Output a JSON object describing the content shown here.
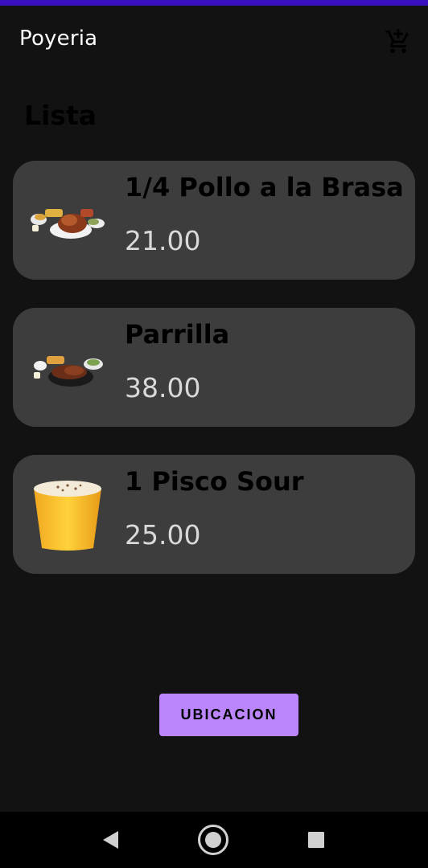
{
  "app": {
    "title": "Poyeria",
    "cart_icon": "add-shopping-cart-icon",
    "status_bar_color": "#3a0fbf"
  },
  "section": {
    "title": "Lista"
  },
  "products": [
    {
      "name": "1/4 Pollo a la Brasa",
      "price": "21.00",
      "image_icon": "roast-chicken-plate-image"
    },
    {
      "name": "Parrilla",
      "price": "38.00",
      "image_icon": "grill-platter-image"
    },
    {
      "name": "1 Pisco Sour",
      "price": "25.00",
      "image_icon": "pisco-sour-glass-image"
    }
  ],
  "actions": {
    "location_button": "UBICACION",
    "accent_color": "#bb86fc"
  },
  "nav": {
    "back_icon": "back-triangle-icon",
    "home_icon": "home-circle-icon",
    "recents_icon": "recents-square-icon"
  }
}
